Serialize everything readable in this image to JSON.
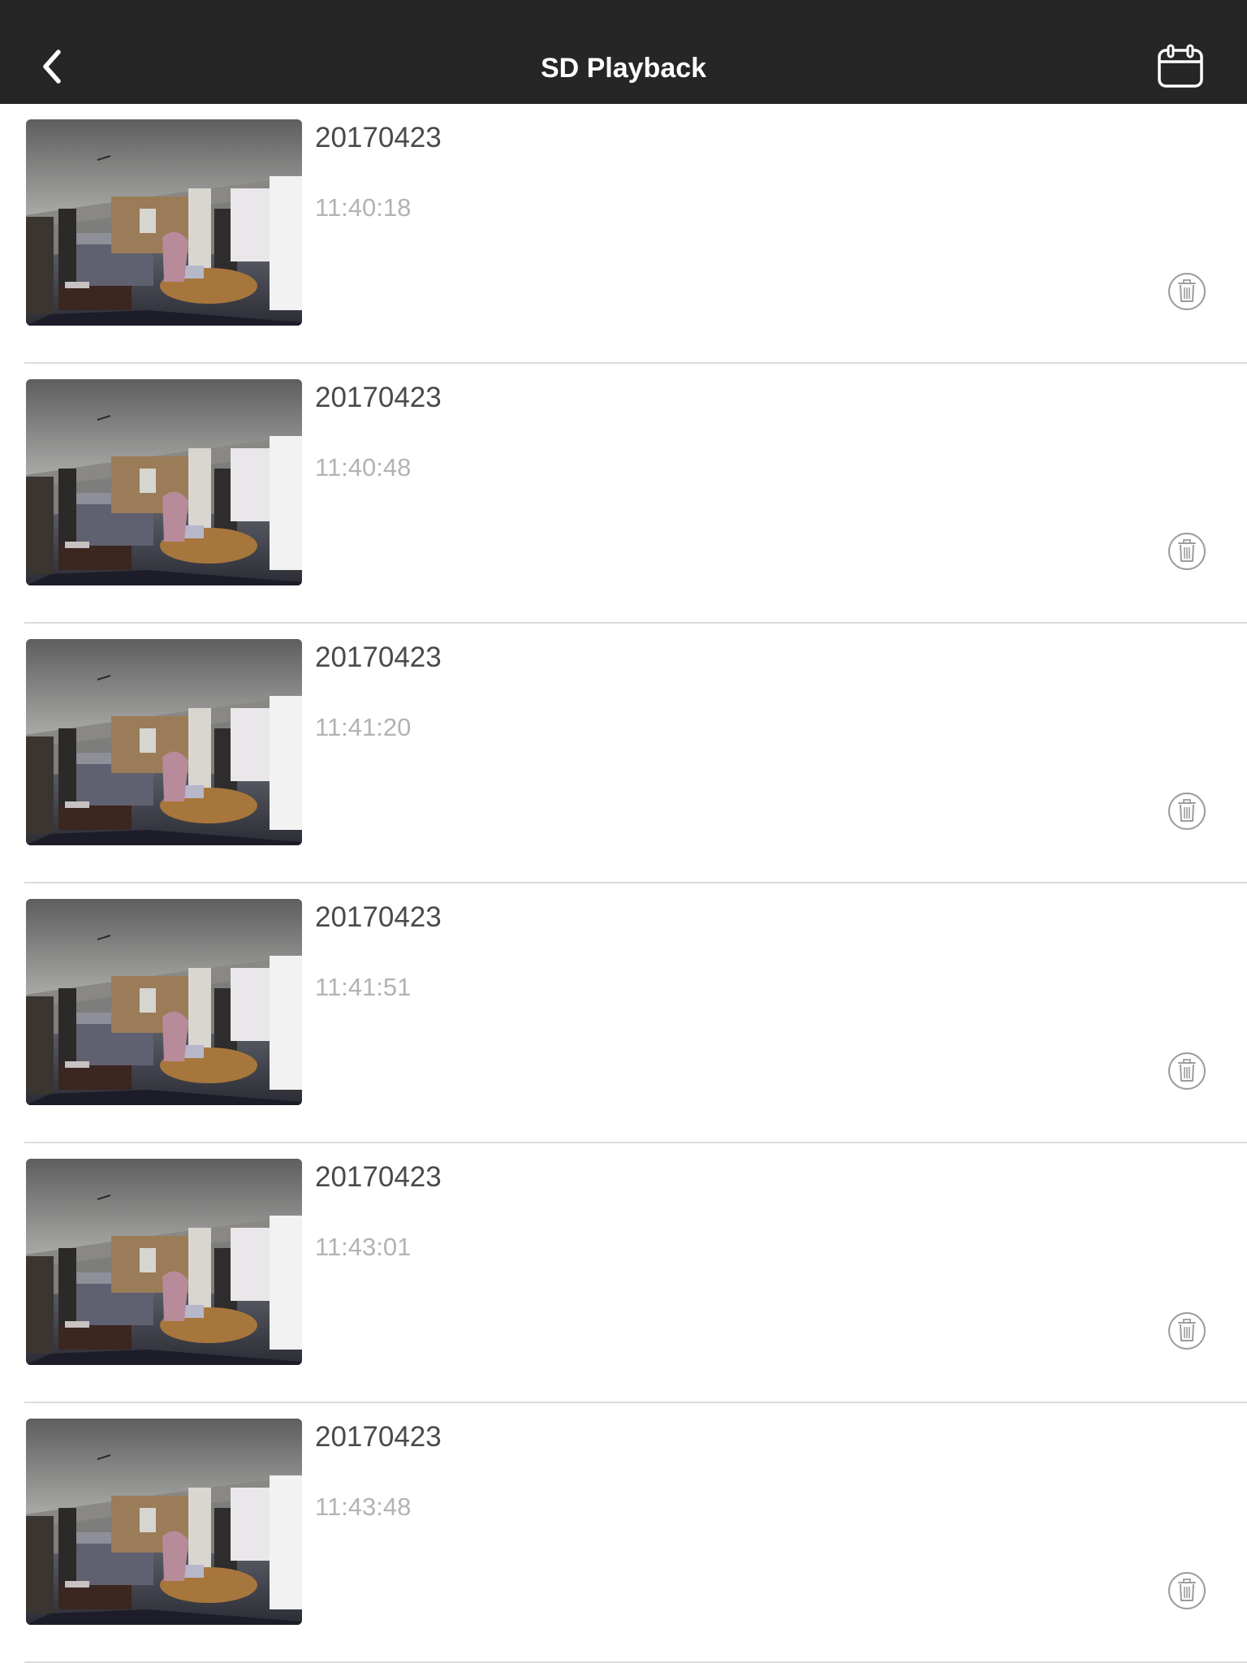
{
  "header": {
    "title": "SD Playback",
    "back_icon": "chevron-left-icon",
    "calendar_icon": "calendar-icon",
    "background_color": "#262626",
    "title_color": "#ffffff"
  },
  "recordings": [
    {
      "date": "20170423",
      "time": "11:40:18"
    },
    {
      "date": "20170423",
      "time": "11:40:48"
    },
    {
      "date": "20170423",
      "time": "11:41:20"
    },
    {
      "date": "20170423",
      "time": "11:41:51"
    },
    {
      "date": "20170423",
      "time": "11:43:01"
    },
    {
      "date": "20170423",
      "time": "11:43:48"
    }
  ],
  "row_icons": {
    "thumbnail": "room-camera-thumbnail",
    "delete": "trash-icon"
  },
  "colors": {
    "date_text": "#4a4a4a",
    "time_text": "#b3b3b3",
    "divider": "#dcdcdc"
  }
}
